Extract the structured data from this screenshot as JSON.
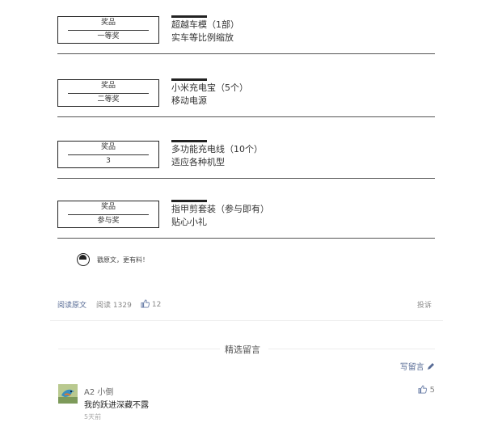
{
  "prizes": [
    {
      "label": "奖品",
      "value": "一等奖",
      "title": "超越车模（1部）",
      "desc": "实车等比例缩放"
    },
    {
      "label": "奖品",
      "value": "二等奖",
      "title": "小米充电宝（5个）",
      "desc": "移动电源"
    },
    {
      "label": "奖品",
      "value": "3",
      "title": "多功能充电线（10个）",
      "desc": "适应各种机型"
    },
    {
      "label": "奖品",
      "value": "参与奖",
      "title": "指甲剪套装（参与即有）",
      "desc": "贴心小礼"
    }
  ],
  "note": "戳原文，更有料！",
  "article_footer": {
    "read_original": "阅读原文",
    "read_label": "阅读",
    "read_count": "1329",
    "like_count": "12",
    "complain": "投诉"
  },
  "comments_section": {
    "title": "精选留言",
    "write": "写留言"
  },
  "comment": {
    "name": "A2 小倒",
    "text": "我的跃进深藏不露",
    "time": "5天前",
    "likes": "5"
  },
  "colors": {
    "link": "#576b95",
    "text": "#333333",
    "muted": "#888888"
  }
}
